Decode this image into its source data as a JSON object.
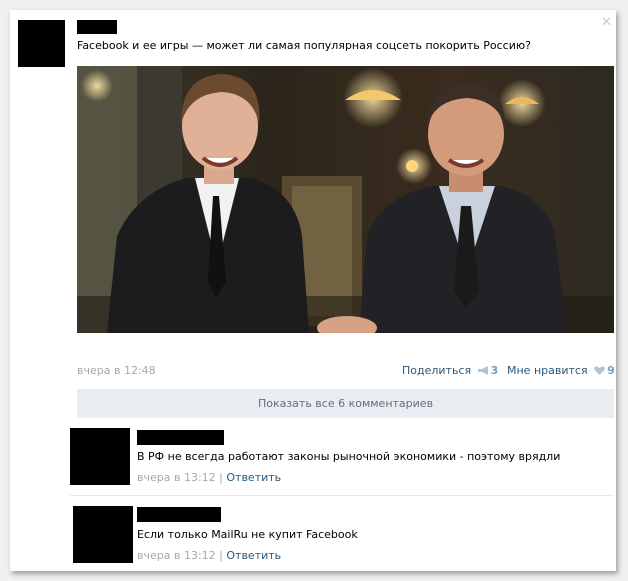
{
  "close_glyph": "✕",
  "post": {
    "text": "Facebook и ее игры — может ли самая популярная соцсеть покорить Россию?",
    "time": "вчера в 12:48",
    "share_label": "Поделиться",
    "share_count": "3",
    "like_label": "Мне нравится",
    "like_count": "9",
    "share_icon": "megaphone-icon",
    "like_icon": "heart-icon"
  },
  "show_all_comments": "Показать все 6 комментариев",
  "comments": [
    {
      "text": "В РФ не всегда работают законы рыночной экономики - поэтому врядли",
      "time": "вчера в 13:12",
      "separator": "|",
      "reply": "Ответить"
    },
    {
      "text": "Если только MailRu не купит Facebook",
      "time": "вчера в 13:12",
      "separator": "|",
      "reply": "Ответить"
    }
  ],
  "colors": {
    "link": "#2b587a",
    "meta": "#a8a8a8",
    "count": "#7a9dbf",
    "show_all_bg": "#e9edf1"
  }
}
